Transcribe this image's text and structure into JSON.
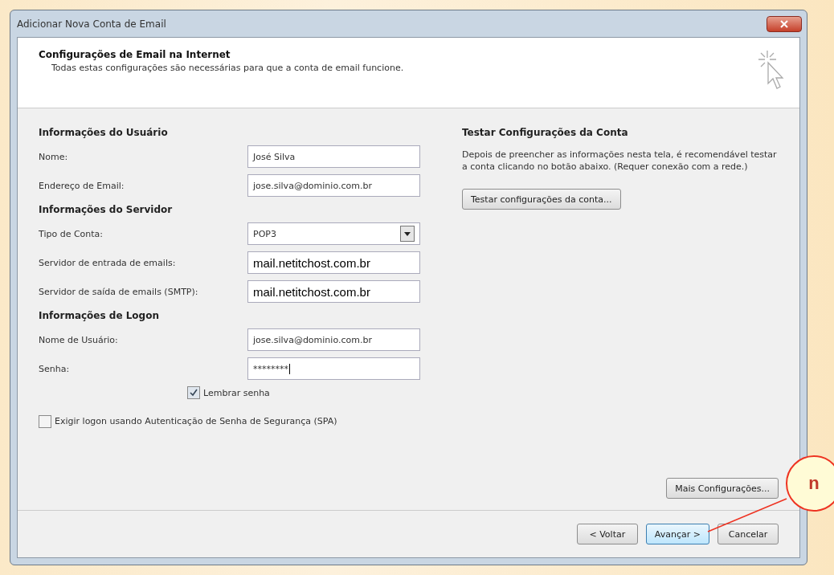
{
  "window": {
    "title": "Adicionar Nova Conta de Email"
  },
  "header": {
    "title": "Configurações de Email na Internet",
    "subtitle": "Todas estas configurações são necessárias para que a conta de email funcione."
  },
  "sections": [
    {
      "heading": "Informações do Usuário",
      "fields": [
        {
          "label": "Nome:",
          "value": "José Silva",
          "kind": "text"
        },
        {
          "label": "Endereço de Email:",
          "value": "jose.silva@dominio.com.br",
          "kind": "text"
        }
      ]
    },
    {
      "heading": "Informações do Servidor",
      "fields": [
        {
          "label": "Tipo de Conta:",
          "value": "POP3",
          "kind": "select"
        },
        {
          "label": "Servidor de entrada de emails:",
          "value": "mail.netitchost.com.br",
          "kind": "pasted"
        },
        {
          "label": "Servidor de saída de emails (SMTP):",
          "value": "mail.netitchost.com.br",
          "kind": "pasted"
        }
      ]
    },
    {
      "heading": "Informações de Logon",
      "fields": [
        {
          "label": "Nome de Usuário:",
          "value": "jose.silva@dominio.com.br",
          "kind": "text"
        },
        {
          "label": "Senha:",
          "value": "********",
          "kind": "password"
        }
      ]
    }
  ],
  "remember": {
    "label": "Lembrar senha",
    "checked": true
  },
  "spa": {
    "label": "Exigir logon usando Autenticação de Senha de Segurança (SPA)",
    "checked": false
  },
  "test": {
    "heading": "Testar Configurações da Conta",
    "text": "Depois de preencher as informações nesta tela, é recomendável testar a conta clicando no botão abaixo. (Requer conexão com a rede.)",
    "button": "Testar configurações da conta..."
  },
  "more_button": "Mais Configurações...",
  "buttons": [
    {
      "label": "< Voltar",
      "selected": false
    },
    {
      "label": "Avançar >",
      "selected": true
    },
    {
      "label": "Cancelar",
      "selected": false
    }
  ],
  "annotation": {
    "label": "n"
  }
}
